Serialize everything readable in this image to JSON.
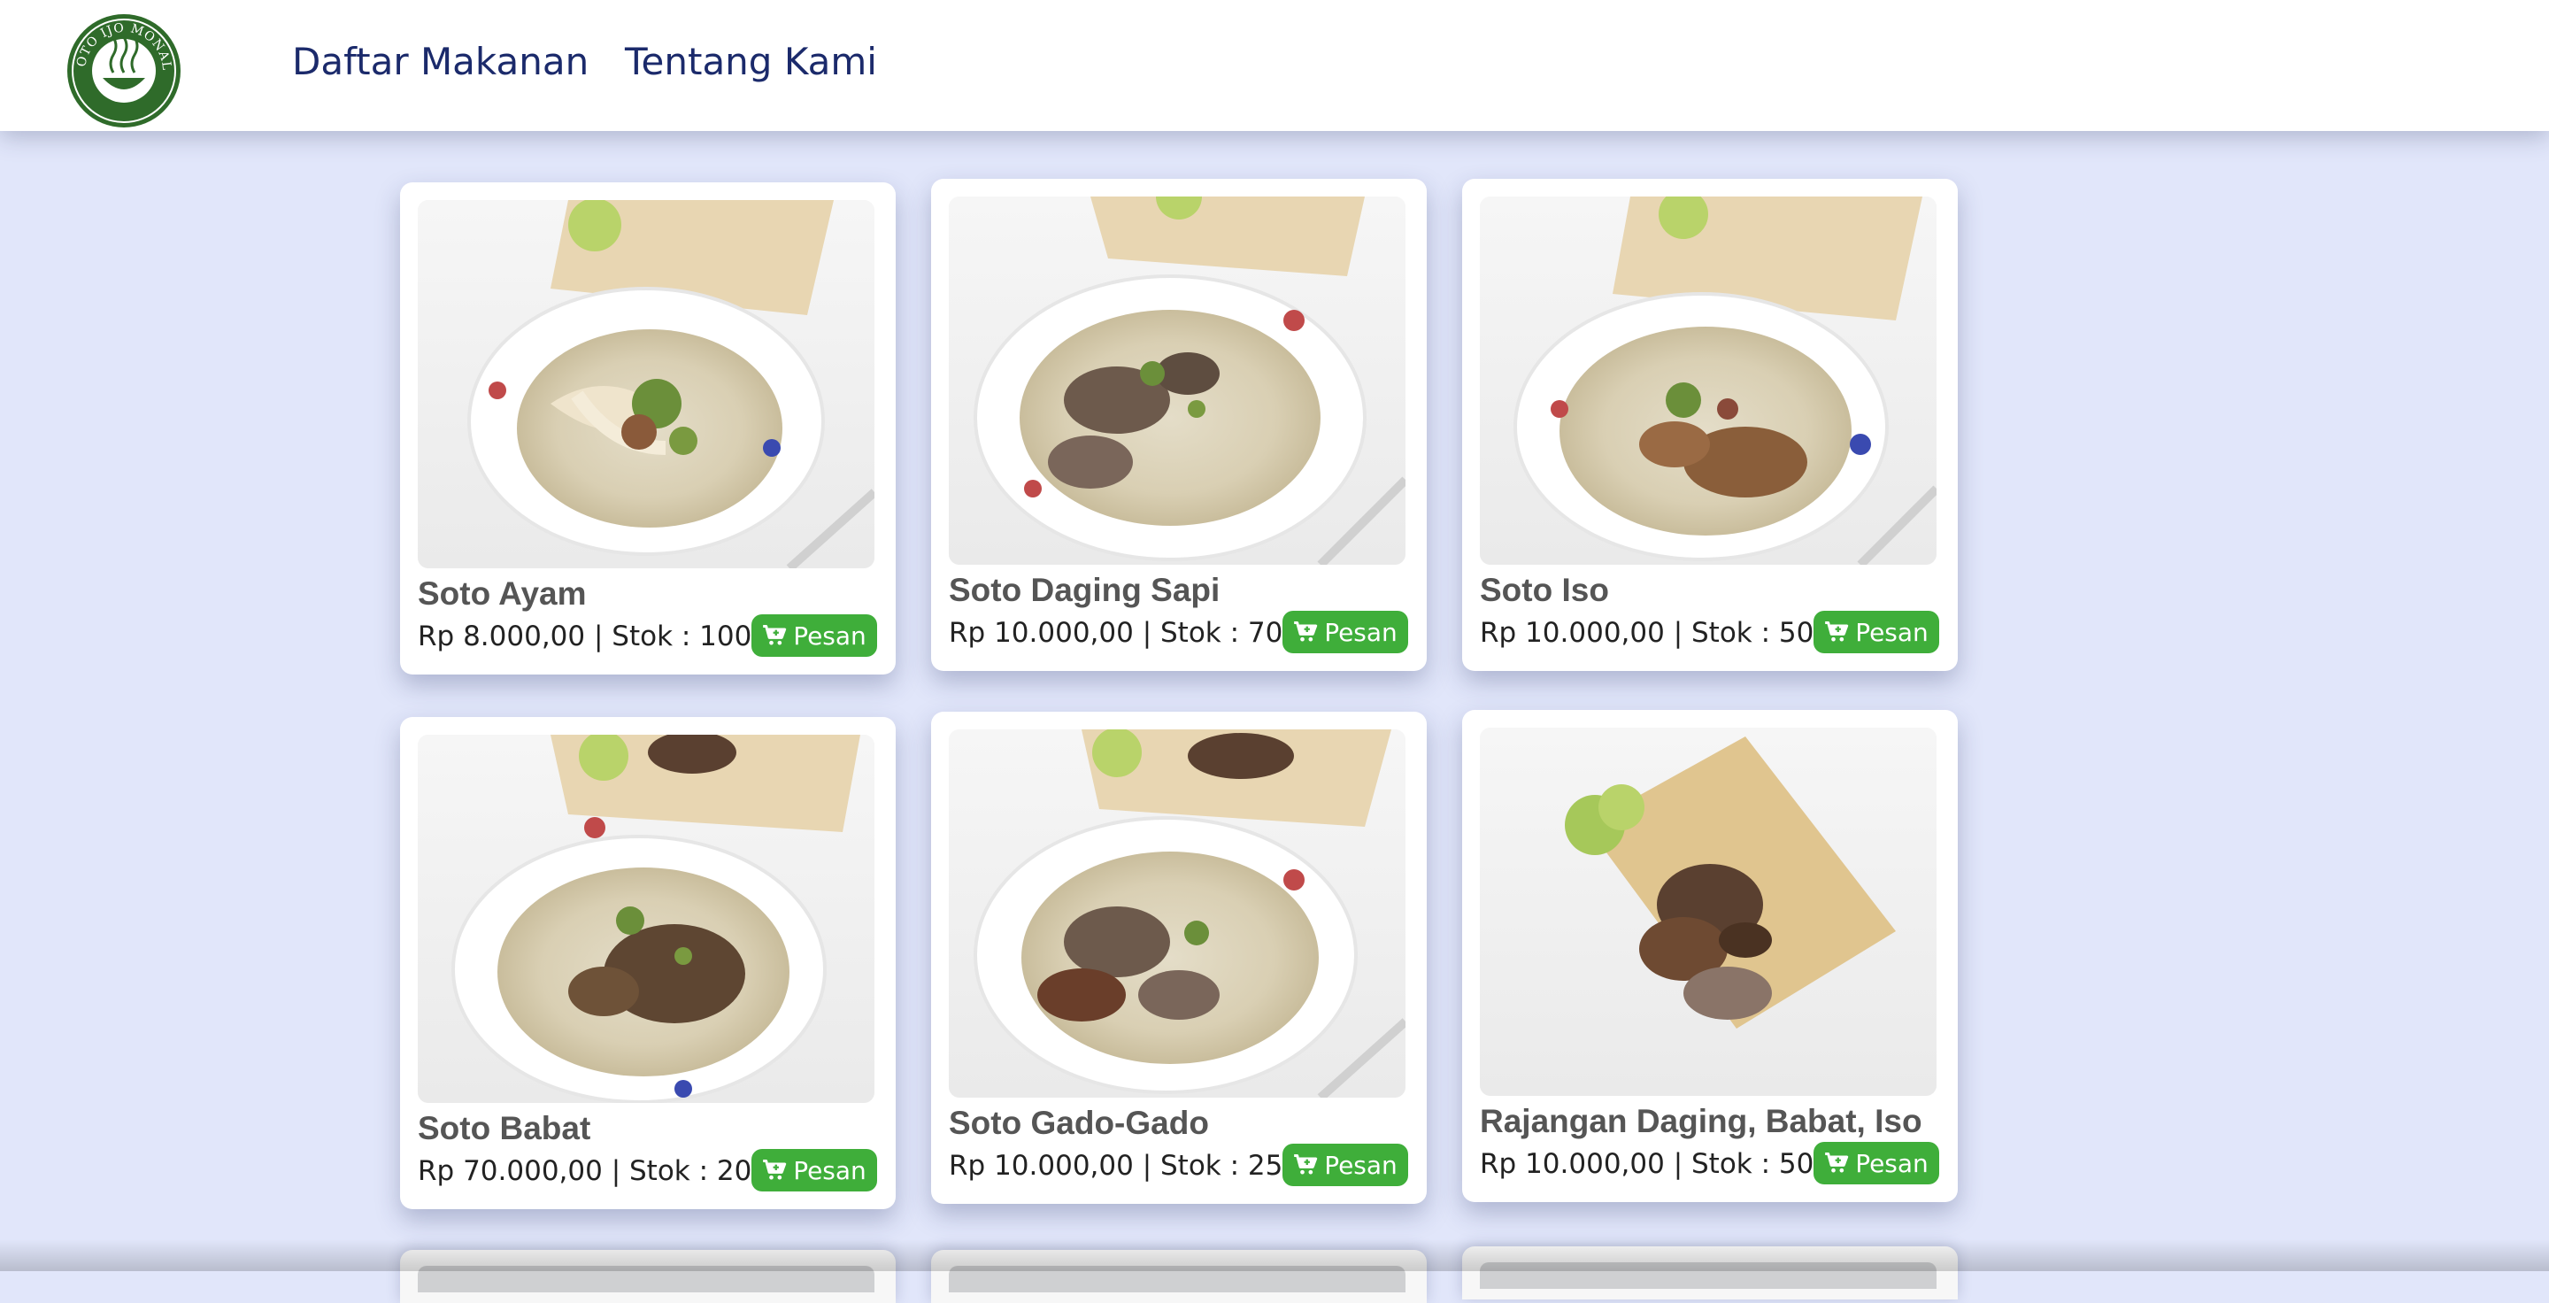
{
  "navbar": {
    "logo_text": "SOTO IJO MONALI",
    "links": [
      "Daftar Makanan",
      "Tentang Kami"
    ]
  },
  "colors": {
    "background": "#e1e6fa",
    "nav_text": "#1b2a6b",
    "button": "#3fae3a",
    "logo_green": "#2f6b2a"
  },
  "menu": [
    {
      "name": "Soto Ayam",
      "price_stock": "Rp 8.000,00 | Stok : 100",
      "button": "Pesan",
      "image": "soto-ayam-photo"
    },
    {
      "name": "Soto Daging Sapi",
      "price_stock": "Rp 10.000,00 | Stok : 70",
      "button": "Pesan",
      "image": "soto-daging-sapi-photo"
    },
    {
      "name": "Soto Iso",
      "price_stock": "Rp 10.000,00 | Stok : 50",
      "button": "Pesan",
      "image": "soto-iso-photo"
    },
    {
      "name": "Soto Babat",
      "price_stock": "Rp 70.000,00 | Stok : 20",
      "button": "Pesan",
      "image": "soto-babat-photo"
    },
    {
      "name": "Soto Gado-Gado",
      "price_stock": "Rp 10.000,00 | Stok : 25",
      "button": "Pesan",
      "image": "soto-gado-gado-photo"
    },
    {
      "name": "Rajangan Daging, Babat, Iso",
      "price_stock": "Rp 10.000,00 | Stok : 50",
      "button": "Pesan",
      "image": "rajangan-photo"
    }
  ],
  "icons": {
    "button_icon": "cart-plus-icon"
  }
}
